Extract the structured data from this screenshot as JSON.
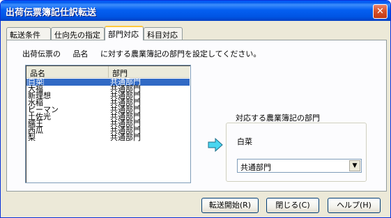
{
  "window": {
    "title": "出荷伝票簿記仕訳転送",
    "close_glyph": "✕"
  },
  "tabs": [
    {
      "label": "転送条件"
    },
    {
      "label": "仕向先の指定"
    },
    {
      "label": "部門対応"
    },
    {
      "label": "科目対応"
    }
  ],
  "instruction": {
    "part1": "出荷伝票の",
    "part2": "品名",
    "part3": "に対する農業簿記の部門を設定してください。"
  },
  "list": {
    "headers": [
      "品名",
      "部門"
    ],
    "rows": [
      {
        "name": "白菜",
        "dept": "共通部門"
      },
      {
        "name": "大福",
        "dept": "共通部門"
      },
      {
        "name": "新理想",
        "dept": "共通部門"
      },
      {
        "name": "水稲",
        "dept": "共通部門"
      },
      {
        "name": "ピーマン",
        "dept": "共通部門"
      },
      {
        "name": "土佐光",
        "dept": "共通部門"
      },
      {
        "name": "繻王",
        "dept": "共通部門"
      },
      {
        "name": "西瓜",
        "dept": "共通部門"
      },
      {
        "name": "梨",
        "dept": "共通部門"
      }
    ]
  },
  "mapping": {
    "group_title": "対応する農業簿記の部門",
    "selected_item": "白菜",
    "dept_value": "共通部門",
    "arrow_icon": "right-arrow-icon",
    "arrow_color": "#4ad6f0"
  },
  "buttons": {
    "start": "転送開始(R)",
    "close": "閉じる(C)",
    "help": "ヘルプ(H)"
  }
}
